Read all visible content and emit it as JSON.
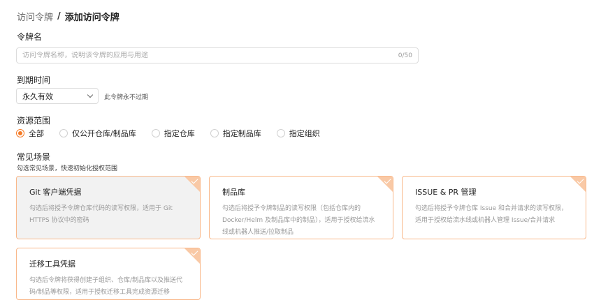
{
  "breadcrumb": {
    "prev": "访问令牌",
    "separator": "/",
    "current": "添加访问令牌"
  },
  "token_name": {
    "label": "令牌名",
    "value": "",
    "placeholder": "访问令牌名称，说明该令牌的应用与用途",
    "counter": "0/50"
  },
  "expiry": {
    "label": "到期时间",
    "selected": "永久有效",
    "hint": "此令牌永不过期"
  },
  "scope": {
    "label": "资源范围",
    "selected_index": 0,
    "options": [
      "全部",
      "仅公开仓库/制品库",
      "指定仓库",
      "指定制品库",
      "指定组织"
    ]
  },
  "scenarios": {
    "label": "常见场景",
    "hint": "勾选常见场景，快速初始化授权范围",
    "cards": [
      {
        "title": "Git 客户端凭据",
        "desc": "勾选后将授予令牌仓库代码的读写权限，适用于 Git HTTPS 协议中的密码",
        "checked": true
      },
      {
        "title": "制品库",
        "desc": "勾选后将授予令牌制品的读写权限（包括仓库内的 Docker/Helm 及制品库中的制品），适用于授权给流水线或机器人推送/拉取制品",
        "checked": false
      },
      {
        "title": "ISSUE & PR 管理",
        "desc": "勾选后将授予令牌仓库 Issue 和合并请求的读写权限，适用于授权给流水线或机器人管理 Issue/合并请求",
        "checked": false
      },
      {
        "title": "迁移工具凭据",
        "desc": "勾选后令牌将获得创建子组织、仓库/制品库以及推送代码/制品等权限，适用于授权迁移工具完成资源迁移",
        "checked": false
      }
    ]
  },
  "colors": {
    "accent": "#f57b27",
    "card_border": "#f9b88a",
    "corner": "#f9c9a6"
  },
  "icons": {
    "dropdown": "chevron-down-icon",
    "card_check": "check-icon"
  }
}
